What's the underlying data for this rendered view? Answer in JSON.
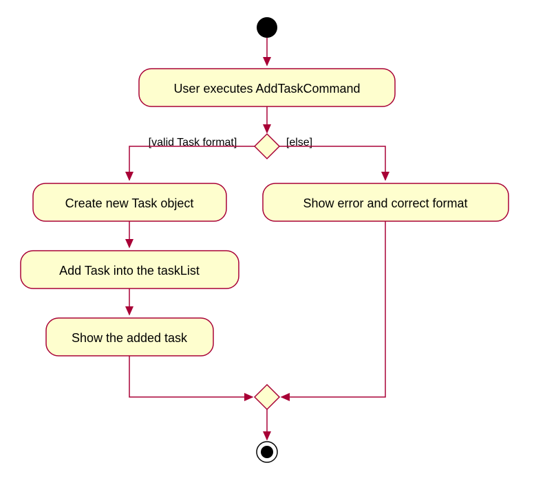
{
  "diagram": {
    "type": "activity",
    "start": true,
    "first_activity": "User executes AddTaskCommand",
    "decision": {
      "left_guard": "[valid Task format]",
      "right_guard": "[else]"
    },
    "left_branch": [
      "Create new Task object",
      "Add Task into the taskList",
      "Show the added task"
    ],
    "right_branch": [
      "Show error and correct format"
    ],
    "merge": true,
    "end": true
  },
  "colors": {
    "fill": "#fefece",
    "stroke": "#a80036"
  }
}
